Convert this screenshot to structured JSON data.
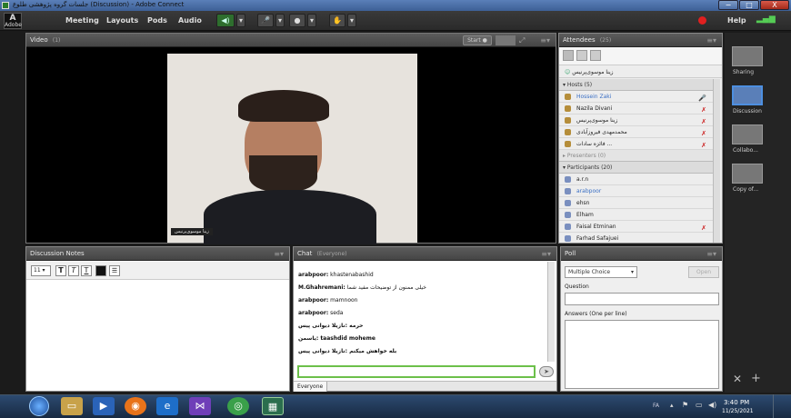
{
  "window": {
    "title": "جلسات گروه پژوهشی طلوع (Discussion) - Adobe Connect",
    "minimize": "−",
    "maximize": "□",
    "close": "X"
  },
  "menubar": {
    "logo": "Adobe",
    "items": [
      "Meeting",
      "Layouts",
      "Pods",
      "Audio"
    ],
    "help": "Help"
  },
  "video": {
    "title": "Video",
    "count": "(1)",
    "start_label": "Start",
    "name_tag": "زینا موسوی‌پرنیس"
  },
  "attendees": {
    "title": "Attendees",
    "count": "(25)",
    "me": "زینا موسوی‌پرنیس",
    "hosts_label": "Hosts (5)",
    "hosts": [
      "Hossein Zaki",
      "Nazila Divani",
      "زینا موسوی‌پرنیس",
      "محمدمهدی فیروزآبادی",
      "فائزه سادات ..."
    ],
    "presenters_label": "Presenters (0)",
    "participants_label": "Participants (20)",
    "participants": [
      "a.r.n",
      "arabpoor",
      "ehsn",
      "Elham",
      "Faisal Etminan",
      "Farhad Safajuei"
    ]
  },
  "layouts": {
    "items": [
      "Sharing",
      "Discussion",
      "Collabo...",
      "Copy of..."
    ]
  },
  "notes": {
    "title": "Discussion Notes",
    "font_size": "11"
  },
  "chat": {
    "title": "Chat",
    "scope": "(Everyone)",
    "messages": [
      {
        "sender": "arabpoor:",
        "text": "khastenabashid"
      },
      {
        "sender": "M.Ghahremani:",
        "text": "خیلی ممنون از توضیحات مفید شما"
      },
      {
        "sender": "arabpoor:",
        "text": "mamnoon"
      },
      {
        "sender": "arabpoor:",
        "text": "seda"
      },
      {
        "sender": "",
        "text": "حرمه :نازیلا دیوانی پیس"
      },
      {
        "sender": "",
        "text": "یاسمن: taashdid moheme"
      },
      {
        "sender": "",
        "text": "بله خواهش میکنم :نازیلا دیوانی پیس"
      }
    ],
    "tab": "Everyone"
  },
  "poll": {
    "title": "Poll",
    "type": "Multiple Choice",
    "open_label": "Open",
    "question_label": "Question",
    "answers_label": "Answers (One per line)"
  },
  "taskbar": {
    "lang": "FA",
    "time": "3:40 PM",
    "date": "11/25/2021"
  }
}
